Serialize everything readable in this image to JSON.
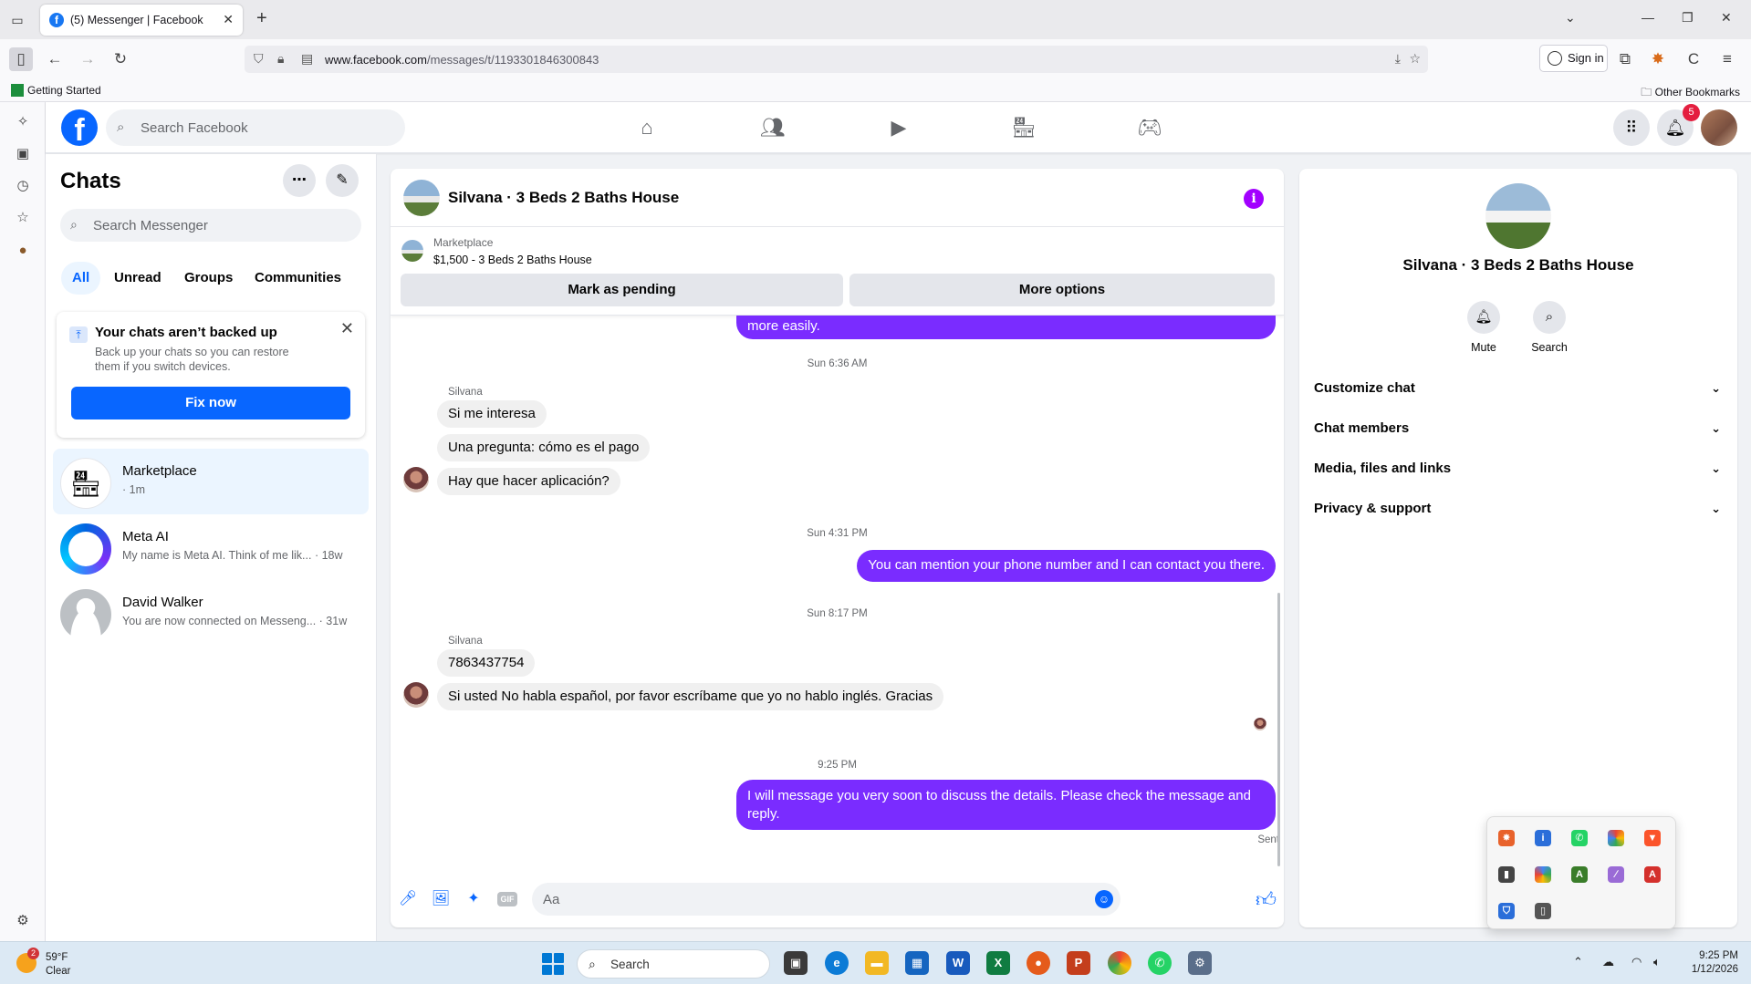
{
  "browser": {
    "tab_title": "(5) Messenger | Facebook",
    "url_host": "www.facebook.com",
    "url_path": "/messages/t/1193301846300843",
    "signin_label": "Sign in",
    "bookmark_getting_started": "Getting Started",
    "bookmark_other": "Other Bookmarks"
  },
  "facebook": {
    "search_placeholder": "Search Facebook",
    "notifications_count": "5"
  },
  "chats": {
    "title": "Chats",
    "search_placeholder": "Search Messenger",
    "filters": [
      "All",
      "Unread",
      "Groups",
      "Communities"
    ],
    "backup": {
      "title": "Your chats aren’t backed up",
      "desc": "Back up your chats so you can restore them if you switch devices.",
      "button": "Fix now"
    },
    "list": [
      {
        "name": "Marketplace",
        "preview": "· 1m"
      },
      {
        "name": "Meta AI",
        "preview": "My name is Meta AI. Think of me lik... · 18w"
      },
      {
        "name": "David Walker",
        "preview": "You are now connected on Messeng... · 31w"
      }
    ]
  },
  "conversation": {
    "title": "Silvana · 3 Beds 2 Baths House",
    "listing_label": "Marketplace",
    "listing_price": "$1,500 - 3 Beds 2 Baths House",
    "btn_pending": "Mark as pending",
    "btn_more": "More options",
    "top_partial": "more easily.",
    "ts1": "Sun 6:36 AM",
    "sender": "Silvana",
    "in1": "Si me interesa",
    "in2": "Una pregunta: cómo es el pago",
    "in3": "Hay que hacer aplicación?",
    "ts2": "Sun 4:31 PM",
    "out1": "You can mention your phone number and I can contact you there.",
    "ts3": "Sun 8:17 PM",
    "in4": "7863437754",
    "in5": "Si usted No habla español, por favor escríbame que yo no hablo inglés. Gracias",
    "ts4": "9:25 PM",
    "out2": "I will message you very soon to discuss the details. Please check the message and reply.",
    "sent": "Sent",
    "composer_placeholder": "Aa"
  },
  "details": {
    "name": "Silvana · 3 Beds 2 Baths House",
    "mute": "Mute",
    "search": "Search",
    "sections": [
      "Customize chat",
      "Chat members",
      "Media, files and links",
      "Privacy & support"
    ]
  },
  "taskbar": {
    "weather_badge": "2",
    "temp": "59°F",
    "condition": "Clear",
    "search_label": "Search",
    "time": "9:25 PM",
    "date": "1/12/2026"
  },
  "colors": {
    "brand": "#0866ff",
    "outgoing_bubble": "#7a2cff",
    "incoming_bubble": "#f0f0f0",
    "info_icon": "#a200ff"
  }
}
